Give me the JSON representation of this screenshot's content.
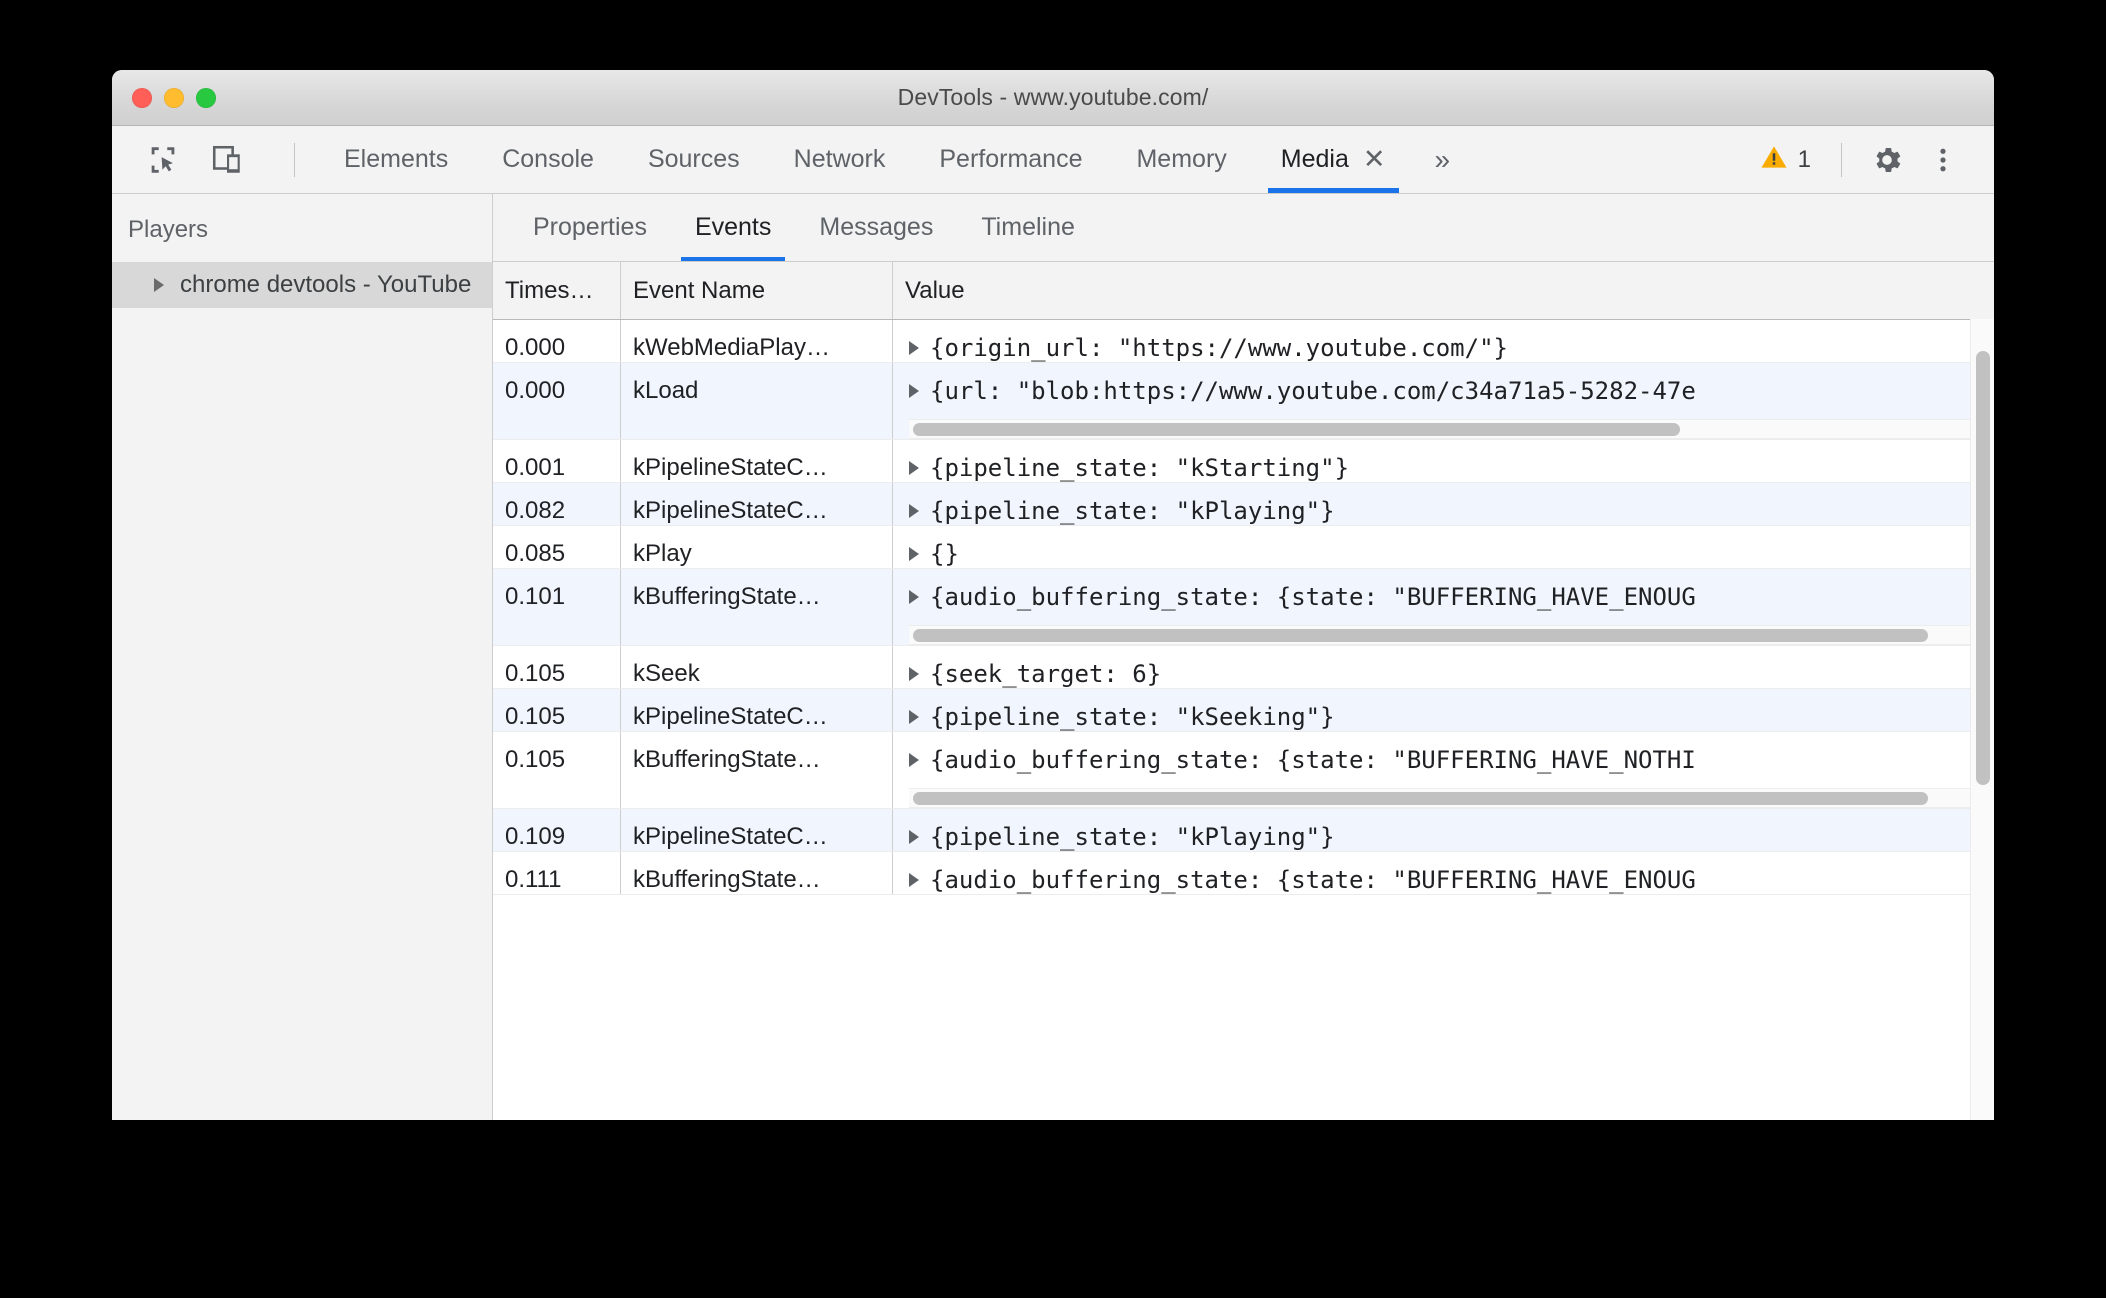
{
  "window": {
    "title": "DevTools - www.youtube.com/",
    "traffic_lights": [
      "close-light",
      "minimize-light",
      "maximize-light"
    ]
  },
  "tabbar": {
    "tools": [
      {
        "name": "inspect-element-icon",
        "label": "Inspect element"
      },
      {
        "name": "device-toolbar-icon",
        "label": "Toggle device toolbar"
      }
    ],
    "tabs": [
      {
        "label": "Elements",
        "active": false,
        "closable": false
      },
      {
        "label": "Console",
        "active": false,
        "closable": false
      },
      {
        "label": "Sources",
        "active": false,
        "closable": false
      },
      {
        "label": "Network",
        "active": false,
        "closable": false
      },
      {
        "label": "Performance",
        "active": false,
        "closable": false
      },
      {
        "label": "Memory",
        "active": false,
        "closable": false
      },
      {
        "label": "Media",
        "active": true,
        "closable": true
      }
    ],
    "close_glyph": "✕",
    "overflow_glyph": "»",
    "warning_count": "1",
    "warning_icon": "warning-triangle-icon",
    "settings_icon": "gear-icon",
    "more_icon": "kebab-menu-icon",
    "accent_color": "#1a73e8",
    "warning_color": "#f9ab00"
  },
  "sidebar": {
    "header": "Players",
    "items": [
      {
        "label": "chrome devtools - YouTube",
        "selected": true,
        "expanded": false
      }
    ]
  },
  "subtabs": [
    {
      "label": "Properties",
      "active": false
    },
    {
      "label": "Events",
      "active": true
    },
    {
      "label": "Messages",
      "active": false
    },
    {
      "label": "Timeline",
      "active": false
    }
  ],
  "table": {
    "columns": [
      "Times…",
      "Event Name",
      "Value"
    ],
    "rows": [
      {
        "time": "0.000",
        "event": "kWebMediaPlay…",
        "value": "{origin_url: \"https://www.youtube.com/\"}",
        "scrollbar": false
      },
      {
        "time": "0.000",
        "event": "kLoad",
        "value": "{url: \"blob:https://www.youtube.com/c34a71a5-5282-47e",
        "scrollbar": true,
        "thumb_percent": 72
      },
      {
        "time": "0.001",
        "event": "kPipelineStateC…",
        "value": "{pipeline_state: \"kStarting\"}",
        "scrollbar": false
      },
      {
        "time": "0.082",
        "event": "kPipelineStateC…",
        "value": "{pipeline_state: \"kPlaying\"}",
        "scrollbar": false
      },
      {
        "time": "0.085",
        "event": "kPlay",
        "value": "{}",
        "scrollbar": false
      },
      {
        "time": "0.101",
        "event": "kBufferingState…",
        "value": "{audio_buffering_state: {state: \"BUFFERING_HAVE_ENOUG",
        "scrollbar": true,
        "thumb_percent": 95
      },
      {
        "time": "0.105",
        "event": "kSeek",
        "value": "{seek_target: 6}",
        "scrollbar": false
      },
      {
        "time": "0.105",
        "event": "kPipelineStateC…",
        "value": "{pipeline_state: \"kSeeking\"}",
        "scrollbar": false
      },
      {
        "time": "0.105",
        "event": "kBufferingState…",
        "value": "{audio_buffering_state: {state: \"BUFFERING_HAVE_NOTHI",
        "scrollbar": true,
        "thumb_percent": 95
      },
      {
        "time": "0.109",
        "event": "kPipelineStateC…",
        "value": "{pipeline_state: \"kPlaying\"}",
        "scrollbar": false
      },
      {
        "time": "0.111",
        "event": "kBufferingState…",
        "value": "{audio_buffering_state: {state: \"BUFFERING_HAVE_ENOUG",
        "scrollbar": false
      }
    ],
    "vertical_scrollbar": {
      "thumb_top_percent": 4,
      "thumb_height_percent": 54
    }
  }
}
